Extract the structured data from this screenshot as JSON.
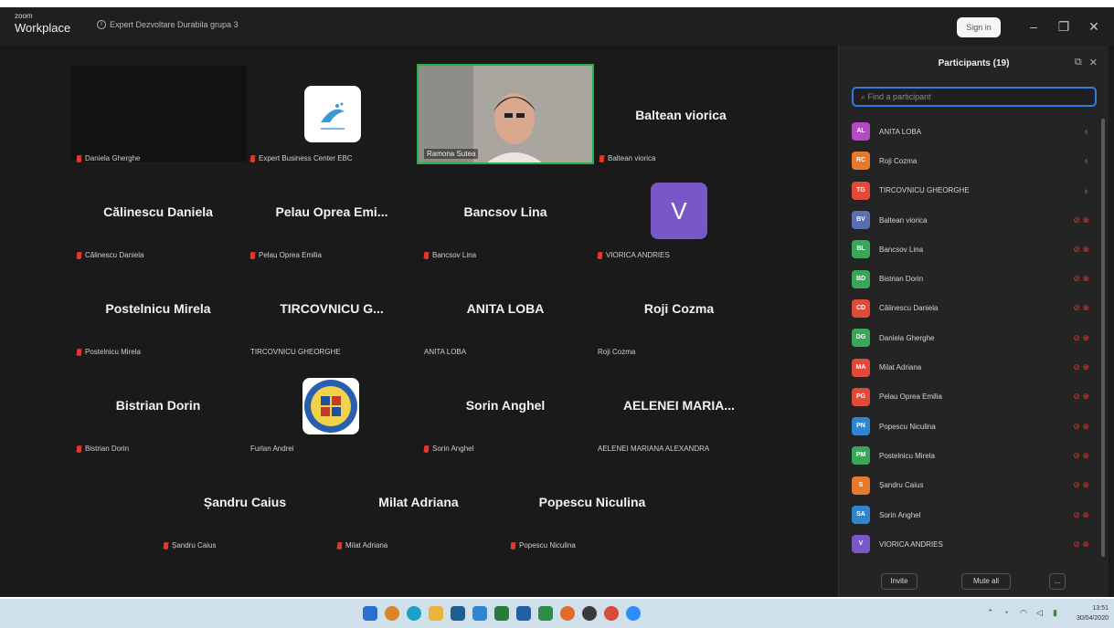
{
  "titlebar": {
    "brand_small": "zoom",
    "brand_big": "Workplace",
    "meeting_title": "Expert Dezvoltare Durabila grupa 3",
    "signin": "Sign in",
    "minimize": "–",
    "restore": "❐",
    "close": "✕"
  },
  "tiles": [
    {
      "big": "",
      "label": "Daniela Gherghe"
    },
    {
      "big": "",
      "label": "Expert Business Center EBC"
    },
    {
      "big": "",
      "label": "Ramona Sutea"
    },
    {
      "big": "Baltean viorica",
      "label": "Baltean viorica"
    },
    {
      "big": "Călinescu Daniela",
      "label": "Călinescu Daniela"
    },
    {
      "big": "Pelau Oprea Emi...",
      "label": "Pelau Oprea Emilia"
    },
    {
      "big": "Bancsov Lina",
      "label": "Bancsov Lina"
    },
    {
      "big": "V",
      "label": "VIORICA ANDRIES"
    },
    {
      "big": "Postelnicu Mirela",
      "label": "Postelnicu Mirela"
    },
    {
      "big": "TIRCOVNICU G...",
      "label": "TIRCOVNICU GHEORGHE"
    },
    {
      "big": "ANITA LOBA",
      "label": "ANITA LOBA"
    },
    {
      "big": "Roji Cozma",
      "label": "Roji Cozma"
    },
    {
      "big": "Bistrian Dorin",
      "label": "Bistrian Dorin"
    },
    {
      "big": "",
      "label": "Furlan Andrei"
    },
    {
      "big": "Sorin Anghel",
      "label": "Sorin Anghel"
    },
    {
      "big": "AELENEI MARIA...",
      "label": "AELENEI MARIANA ALEXANDRA"
    },
    {
      "big": "Șandru Caius",
      "label": "Șandru Caius"
    },
    {
      "big": "Milat Adriana",
      "label": "Milat Adriana"
    },
    {
      "big": "Popescu Niculina",
      "label": "Popescu Niculina"
    }
  ],
  "panel": {
    "title": "Participants (19)",
    "search_placeholder": "Find a participant",
    "invite": "Invite",
    "mute_all": "Mute all",
    "more": "...",
    "participants": [
      {
        "initials": "AL",
        "name": "ANITA LOBA",
        "color": "#b44ac4",
        "status": "on"
      },
      {
        "initials": "RC",
        "name": "Roji Cozma",
        "color": "#e8782a",
        "status": "on"
      },
      {
        "initials": "TG",
        "name": "TIRCOVNICU GHEORGHE",
        "color": "#e04a3a",
        "status": "on"
      },
      {
        "initials": "BV",
        "name": "Baltean viorica",
        "color": "#5a6fb0",
        "status": "off"
      },
      {
        "initials": "BL",
        "name": "Bancsov Lina",
        "color": "#3aa65a",
        "status": "off"
      },
      {
        "initials": "BD",
        "name": "Bistrian Dorin",
        "color": "#3aa65a",
        "status": "off"
      },
      {
        "initials": "CD",
        "name": "Călinescu Daniela",
        "color": "#e04a3a",
        "status": "off"
      },
      {
        "initials": "DG",
        "name": "Daniela Gherghe",
        "color": "#3aa65a",
        "status": "off"
      },
      {
        "initials": "MA",
        "name": "Milat Adriana",
        "color": "#e04a3a",
        "status": "off"
      },
      {
        "initials": "PG",
        "name": "Pelau Oprea Emilia",
        "color": "#e04a3a",
        "status": "off"
      },
      {
        "initials": "PN",
        "name": "Popescu Niculina",
        "color": "#2f86d0",
        "status": "off"
      },
      {
        "initials": "PM",
        "name": "Postelnicu Mirela",
        "color": "#3aa65a",
        "status": "off"
      },
      {
        "initials": "S",
        "name": "Șandru Caius",
        "color": "#e8782a",
        "status": "off"
      },
      {
        "initials": "SA",
        "name": "Sorin Anghel",
        "color": "#2f86d0",
        "status": "off"
      },
      {
        "initials": "V",
        "name": "VIORICA ANDRIES",
        "color": "#7a57c8",
        "status": "off"
      }
    ]
  },
  "taskbar": {
    "time": "13:51",
    "date": "30/04/2020"
  },
  "colors": {
    "active_speaker": "#23b14d",
    "muted": "#e0372f",
    "search_focus": "#2f7be0"
  }
}
